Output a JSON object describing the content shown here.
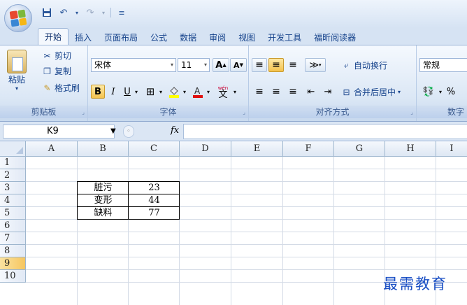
{
  "tabs": [
    {
      "label": "开始",
      "active": true
    },
    {
      "label": "插入"
    },
    {
      "label": "页面布局"
    },
    {
      "label": "公式"
    },
    {
      "label": "数据"
    },
    {
      "label": "审阅"
    },
    {
      "label": "视图"
    },
    {
      "label": "开发工具"
    },
    {
      "label": "福昕阅读器"
    }
  ],
  "ribbon": {
    "clipboard": {
      "paste": "粘贴",
      "cut": "剪切",
      "copy": "复制",
      "format_painter": "格式刷",
      "label": "剪贴板"
    },
    "font": {
      "name": "宋体",
      "size": "11",
      "bold": "B",
      "italic": "I",
      "underline": "U",
      "grow": "A",
      "shrink": "A",
      "wen": "wén",
      "label": "字体"
    },
    "alignment": {
      "wrap": "自动换行",
      "merge": "合并后居中",
      "label": "对齐方式"
    },
    "number": {
      "format": "常规",
      "percent": "%",
      "label": "数字"
    }
  },
  "formula_bar": {
    "name_box": "K9",
    "fx": "fx",
    "value": ""
  },
  "sheet": {
    "columns": [
      "A",
      "B",
      "C",
      "D",
      "E",
      "F",
      "G",
      "H",
      "I"
    ],
    "rows": [
      "1",
      "2",
      "3",
      "4",
      "5",
      "6",
      "7",
      "8",
      "9",
      "10"
    ],
    "cells": {
      "B3": "脏污",
      "C3": "23",
      "B4": "变形",
      "C4": "44",
      "B5": "缺料",
      "C5": "77"
    }
  },
  "watermark": "最需教育",
  "colors": {
    "accent": "#15428b",
    "selected_row": "#f6c65f",
    "watermark": "#1a4fc4"
  }
}
